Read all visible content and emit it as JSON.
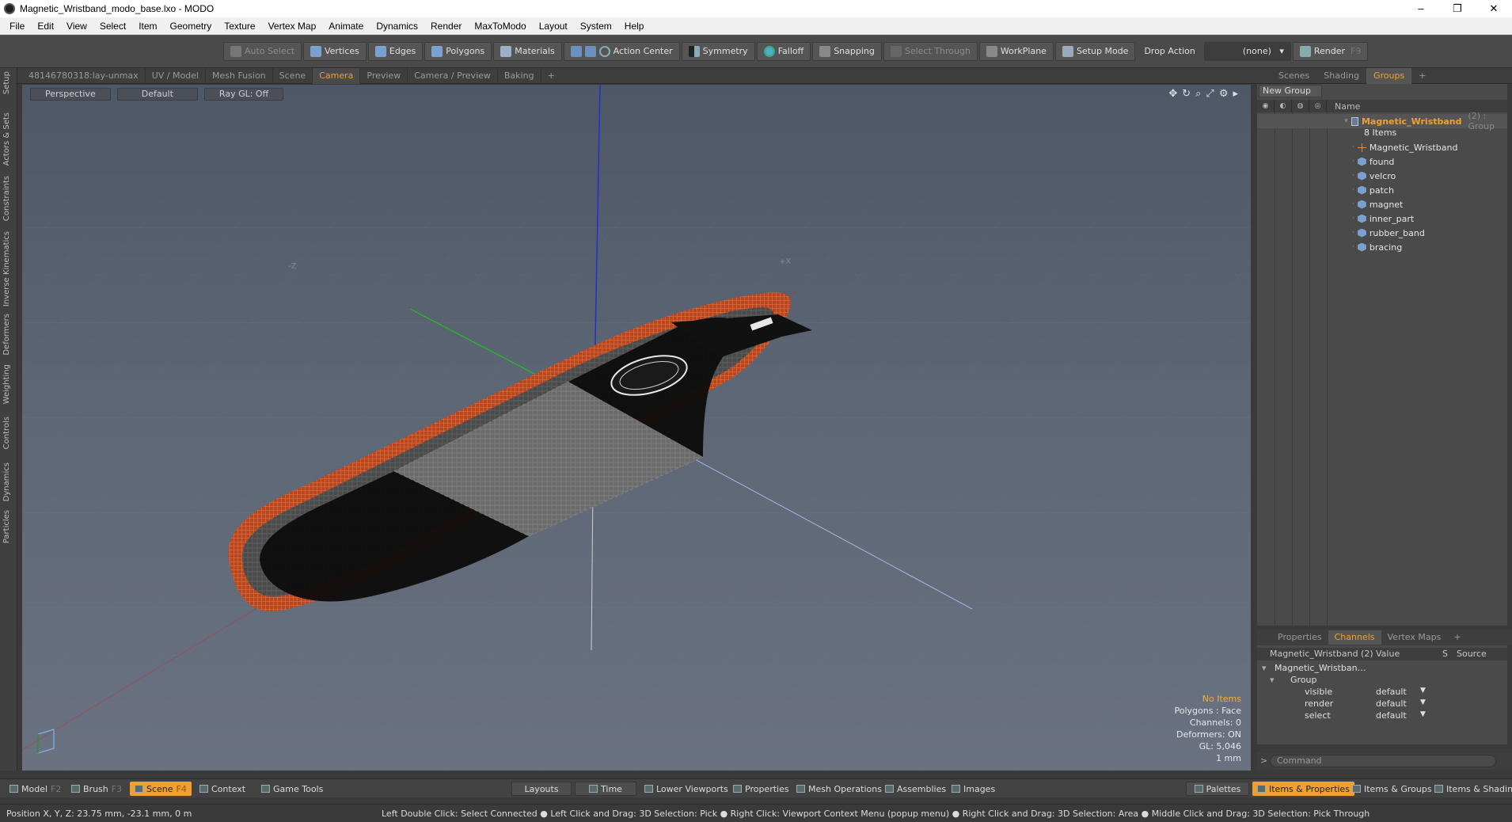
{
  "window": {
    "title": "Magnetic_Wristband_modo_base.lxo - MODO",
    "minimize": "–",
    "maximize": "❐",
    "close": "✕"
  },
  "menu": [
    "File",
    "Edit",
    "View",
    "Select",
    "Item",
    "Geometry",
    "Texture",
    "Vertex Map",
    "Animate",
    "Dynamics",
    "Render",
    "MaxToModo",
    "Layout",
    "System",
    "Help"
  ],
  "toolbar": {
    "auto_select": "Auto Select",
    "vertices": "Vertices",
    "edges": "Edges",
    "polygons": "Polygons",
    "materials": "Materials",
    "action_center": "Action Center",
    "symmetry": "Symmetry",
    "falloff": "Falloff",
    "snapping": "Snapping",
    "select_through": "Select Through",
    "workplane": "WorkPlane",
    "setup_mode": "Setup Mode",
    "drop_action": "Drop Action",
    "drop_value": "(none)",
    "render": "Render",
    "render_key": "F9"
  },
  "left_tabs": [
    "Setup",
    "Actors & Sets",
    "Constraints",
    "Inverse Kinematics",
    "Deformers",
    "Weighting",
    "Controls",
    "Dynamics",
    "Particles"
  ],
  "viewport_tabs": [
    "48146780318:lay-unmax",
    "UV / Model",
    "Mesh Fusion",
    "Scene",
    "Camera",
    "Preview",
    "Camera / Preview",
    "Baking",
    "+"
  ],
  "viewport": {
    "perspective": "Perspective",
    "shading": "Default",
    "raygl": "Ray GL: Off",
    "info_no_items": "No Items",
    "info_polygons": "Polygons : Face",
    "info_channels": "Channels: 0",
    "info_deformers": "Deformers: ON",
    "info_gl": "GL: 5,046",
    "info_scale": "1 mm",
    "axis_z_label": "-Z",
    "axis_x_label": "+X"
  },
  "right_tabs": [
    "Scenes",
    "Shading",
    "Groups",
    "+"
  ],
  "groups": {
    "new_group": "New Group",
    "col_name": "Name",
    "root_name": "Magnetic_Wristband",
    "root_suffix": "(2) : Group",
    "items_count": "8 Items",
    "items": [
      "Magnetic_Wristband",
      "found",
      "velcro",
      "patch",
      "magnet",
      "inner_part",
      "rubber_band",
      "bracing"
    ]
  },
  "channel_tabs": [
    "Properties",
    "Channels",
    "Vertex Maps",
    "+"
  ],
  "channels": {
    "head_name": "Magnetic_Wristband (2)",
    "head_value": "Value",
    "head_s": "S",
    "head_source": "Source",
    "item": "Magnetic_Wristban…",
    "group": "Group",
    "rows": [
      {
        "name": "visible",
        "value": "default"
      },
      {
        "name": "render",
        "value": "default"
      },
      {
        "name": "select",
        "value": "default"
      }
    ],
    "command_placeholder": "Command"
  },
  "bottom": {
    "model": "Model",
    "model_key": "F2",
    "brush": "Brush",
    "brush_key": "F3",
    "scene": "Scene",
    "scene_key": "F4",
    "context": "Context",
    "game_tools": "Game Tools",
    "layouts": "Layouts",
    "time": "Time",
    "lower_viewports": "Lower Viewports",
    "properties": "Properties",
    "mesh_operations": "Mesh Operations",
    "assemblies": "Assemblies",
    "images": "Images",
    "palettes": "Palettes",
    "items_properties": "Items & Properties",
    "items_groups": "Items & Groups",
    "items_shading": "Items & Shading"
  },
  "status": {
    "position": "Position X, Y, Z:   23.75 mm, -23.1 mm, 0 m",
    "hints": "Left Double Click: Select Connected ● Left Click and Drag: 3D Selection: Pick ● Right Click: Viewport Context Menu (popup menu) ● Right Click and Drag: 3D Selection: Area ● Middle Click and Drag: 3D Selection: Pick Through"
  },
  "colors": {
    "accent": "#f0a030",
    "viewport_top": "#4e5766",
    "viewport_bottom": "#6a7281",
    "band_orange": "#c8502a"
  }
}
